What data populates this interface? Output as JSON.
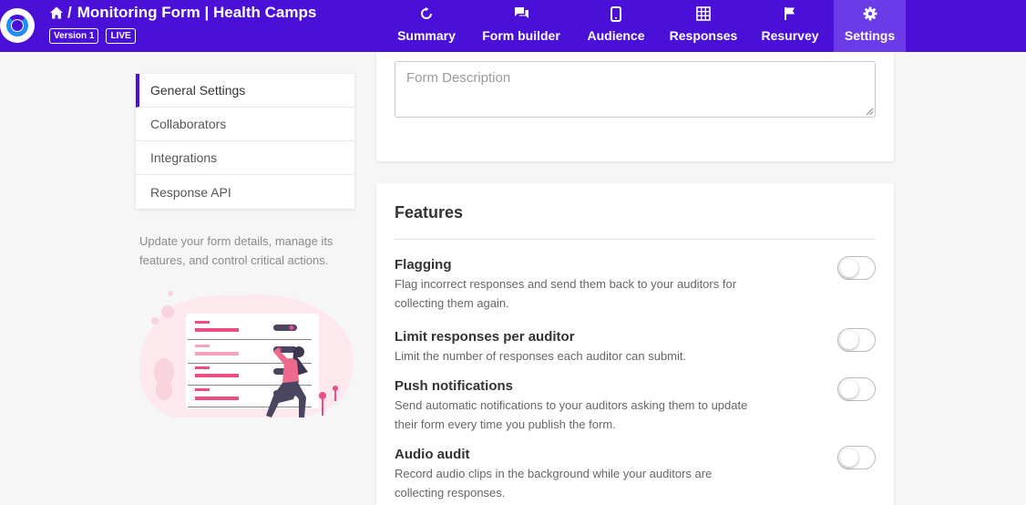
{
  "header": {
    "form_title": "Monitoring Form | Health Camps",
    "separator": "/",
    "version_badge": "Version 1",
    "status_badge": "LIVE",
    "brand_color": "#4a10d8"
  },
  "nav": {
    "tabs": [
      {
        "label": "Summary",
        "icon": "refresh-icon"
      },
      {
        "label": "Form builder",
        "icon": "chat-icon"
      },
      {
        "label": "Audience",
        "icon": "phone-icon"
      },
      {
        "label": "Responses",
        "icon": "grid-icon"
      },
      {
        "label": "Resurvey",
        "icon": "flag-icon"
      },
      {
        "label": "Settings",
        "icon": "gear-icon",
        "active": true
      }
    ]
  },
  "sidebar": {
    "items": [
      {
        "label": "General Settings",
        "active": true
      },
      {
        "label": "Collaborators"
      },
      {
        "label": "Integrations"
      },
      {
        "label": "Response API"
      }
    ],
    "description": "Update your form details, manage its features, and control critical actions."
  },
  "general": {
    "description_placeholder": "Form Description"
  },
  "features": {
    "title": "Features",
    "items": [
      {
        "name": "Flagging",
        "description": "Flag incorrect responses and send them back to your auditors for collecting them again.",
        "enabled": false
      },
      {
        "name": "Limit responses per auditor",
        "description": "Limit the number of responses each auditor can submit.",
        "enabled": false
      },
      {
        "name": "Push notifications",
        "description": "Send automatic notifications to your auditors asking them to update their form every time you publish the form.",
        "enabled": false
      },
      {
        "name": "Audio audit",
        "description": "Record audio clips in the background while your auditors are collecting responses.",
        "enabled": false
      }
    ]
  }
}
